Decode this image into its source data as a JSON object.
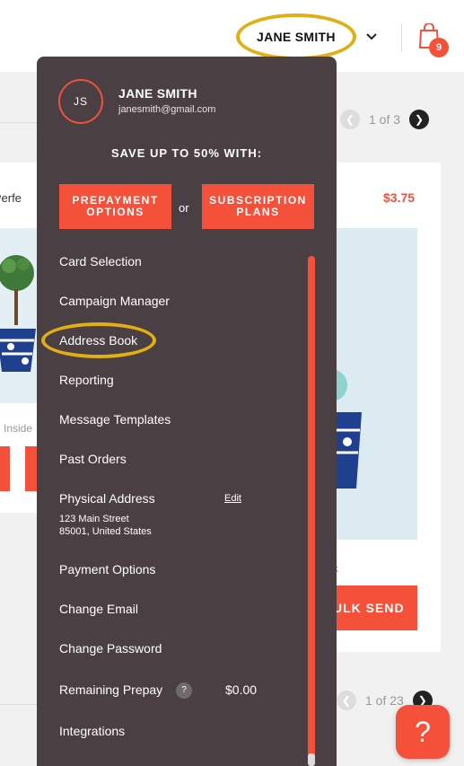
{
  "header": {
    "user_name": "JANE SMITH",
    "cart_count": "9"
  },
  "background": {
    "pager_top": {
      "current": "1 of 3"
    },
    "pager_bottom": {
      "current": "1 of 23"
    },
    "card_left_title": "o Perfe",
    "card_left_inside": "Inside",
    "card_right_price": "$3.75",
    "card_right_k": "k",
    "card_right_button": "ULK SEND",
    "help_label": "?"
  },
  "dropdown": {
    "avatar_initials": "JS",
    "name": "JANE SMITH",
    "email": "janesmith@gmail.com",
    "save_text": "SAVE UP TO 50% WITH:",
    "prepayment_button": "PREPAYMENT OPTIONS",
    "or_text": "or",
    "subscription_button": "SUBSCRIPTION PLANS",
    "items": [
      {
        "label": "Card Selection"
      },
      {
        "label": "Campaign Manager"
      },
      {
        "label": "Address Book"
      },
      {
        "label": "Reporting"
      },
      {
        "label": "Message Templates"
      },
      {
        "label": "Past Orders"
      },
      {
        "label": "Physical Address"
      },
      {
        "label": "Payment Options"
      },
      {
        "label": "Change Email"
      },
      {
        "label": "Change Password"
      },
      {
        "label": "Remaining Prepay"
      },
      {
        "label": "Integrations"
      }
    ],
    "edit_label": "Edit",
    "address_line1": "123 Main Street",
    "address_line2": "85001, United States",
    "prepay_help": "?",
    "prepay_value": "$0.00"
  },
  "colors": {
    "accent": "#f4503a",
    "dropdown_bg": "#4a3f43",
    "highlight": "#e1ae14"
  }
}
